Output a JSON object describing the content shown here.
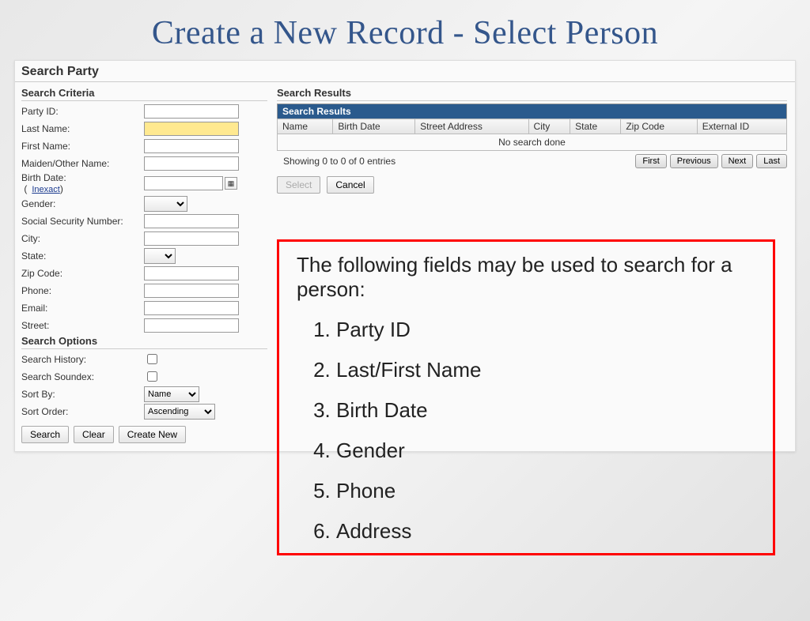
{
  "slide_title": "Create a New Record - Select Person",
  "panel_title": "Search Party",
  "criteria": {
    "header": "Search Criteria",
    "fields": {
      "party_id": "Party ID:",
      "last_name": "Last Name:",
      "first_name": "First Name:",
      "maiden": "Maiden/Other Name:",
      "birth_date": "Birth Date:",
      "inexact": "Inexact",
      "gender": "Gender:",
      "ssn": "Social Security Number:",
      "city": "City:",
      "state": "State:",
      "zip": "Zip Code:",
      "phone": "Phone:",
      "email": "Email:",
      "street": "Street:"
    }
  },
  "options": {
    "header": "Search Options",
    "history": "Search History:",
    "soundex": "Search Soundex:",
    "sort_by": "Sort By:",
    "sort_by_value": "Name",
    "sort_order": "Sort Order:",
    "sort_order_value": "Ascending"
  },
  "buttons": {
    "search": "Search",
    "clear": "Clear",
    "create_new": "Create New",
    "select": "Select",
    "cancel": "Cancel"
  },
  "results": {
    "header": "Search Results",
    "caption": "Search Results",
    "cols": {
      "name": "Name",
      "birth": "Birth Date",
      "street": "Street Address",
      "city": "City",
      "state": "State",
      "zip": "Zip Code",
      "ext": "External ID"
    },
    "empty": "No search done",
    "showing": "Showing 0 to 0 of 0 entries",
    "pager": {
      "first": "First",
      "prev": "Previous",
      "next": "Next",
      "last": "Last"
    }
  },
  "callout": {
    "intro": "The following fields may be used to search for a person:",
    "items": [
      "Party ID",
      "Last/First Name",
      "Birth Date",
      "Gender",
      "Phone",
      "Address"
    ]
  }
}
